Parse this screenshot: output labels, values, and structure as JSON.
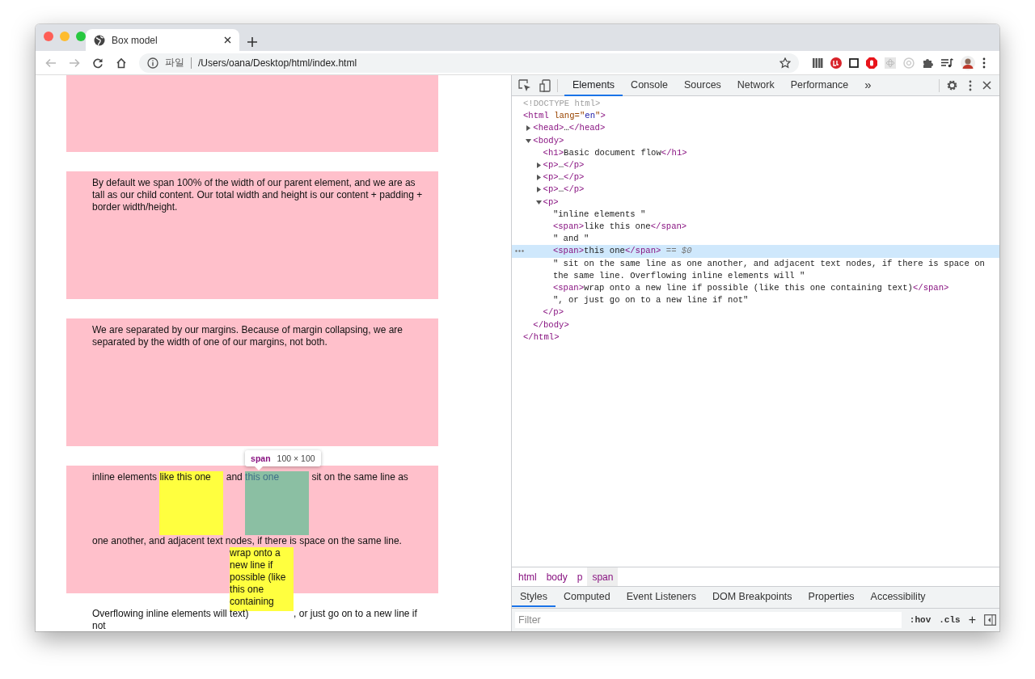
{
  "browser": {
    "tabs": [
      {
        "title": "Box model",
        "selected": true
      }
    ],
    "nav": [
      {
        "kind": "back",
        "disabled": true
      },
      {
        "kind": "forward",
        "disabled": true
      },
      {
        "kind": "reload",
        "disabled": false
      },
      {
        "kind": "home",
        "disabled": false
      }
    ],
    "address": {
      "scheme_label": "파일",
      "url": "/Users/oana/Desktop/html/index.html"
    },
    "extensions": [
      {
        "kind": "bars"
      },
      {
        "kind": "red-badge"
      },
      {
        "kind": "square"
      },
      {
        "kind": "stop-sign"
      },
      {
        "kind": "atom"
      },
      {
        "kind": "ring"
      },
      {
        "kind": "puzzle"
      },
      {
        "kind": "playlist"
      }
    ]
  },
  "page": {
    "blocks": [
      {
        "kind": "empty"
      },
      {
        "kind": "text",
        "text": "By default we span 100% of the width of our parent element, and we are as tall as our child content. Our total width and height is our content + padding + border width/height."
      },
      {
        "kind": "text",
        "text": "We are separated by our margins. Because of margin collapsing, we are separated by the width of one of our margins, not both."
      },
      {
        "kind": "inline",
        "lines": [
          [
            {
              "kind": "text",
              "text": "inline elements "
            },
            {
              "kind": "span",
              "text": "like this one",
              "inspected": false
            },
            {
              "kind": "text",
              "text": " and "
            },
            {
              "kind": "span",
              "text": "this one",
              "inspected": true,
              "tooltip": {
                "tag": "span",
                "size": "100 × 100"
              }
            },
            {
              "kind": "text",
              "text": " sit on the same line as"
            }
          ],
          [
            {
              "kind": "text",
              "text": "one another, and adjacent text nodes, if there is space on the same line."
            }
          ],
          [
            {
              "kind": "text",
              "text": "Overflowing inline elements will "
            },
            {
              "kind": "span",
              "text": "wrap onto a new line if possible (like this one containing text)",
              "inspected": false
            },
            {
              "kind": "text",
              "text": ", or just go on to a new line if"
            }
          ],
          [
            {
              "kind": "text",
              "text": "not"
            }
          ]
        ]
      }
    ]
  },
  "devtools": {
    "tabs": [
      {
        "label": "Elements",
        "selected": true
      },
      {
        "label": "Console",
        "selected": false
      },
      {
        "label": "Sources",
        "selected": false
      },
      {
        "label": "Network",
        "selected": false
      },
      {
        "label": "Performance",
        "selected": false
      }
    ],
    "more_tabs": "»",
    "tree": [
      {
        "selected": false,
        "tokens": [
          {
            "kind": "doctype",
            "text": "<!DOCTYPE html>"
          }
        ]
      },
      {
        "selected": false,
        "tokens": [
          {
            "kind": "tag",
            "text": "<html"
          },
          {
            "kind": "attr",
            "text": " lang=\""
          },
          {
            "kind": "value",
            "text": "en"
          },
          {
            "kind": "attr",
            "text": "\""
          },
          {
            "kind": "tag",
            "text": ">"
          }
        ],
        "close": [
          {
            "kind": "tag",
            "text": "</html>"
          }
        ],
        "children": [
          {
            "selected": false,
            "expanded": false,
            "tokens": [
              {
                "kind": "tag",
                "text": "<head>"
              },
              {
                "kind": "text",
                "text": "…"
              },
              {
                "kind": "tag",
                "text": "</head>"
              }
            ]
          },
          {
            "selected": false,
            "expanded": true,
            "tokens": [
              {
                "kind": "tag",
                "text": "<body>"
              }
            ],
            "close": [
              {
                "kind": "tag",
                "text": "</body>"
              }
            ],
            "children": [
              {
                "selected": false,
                "tokens": [
                  {
                    "kind": "tag",
                    "text": "<h1>"
                  },
                  {
                    "kind": "text",
                    "text": "Basic document flow"
                  },
                  {
                    "kind": "tag",
                    "text": "</h1>"
                  }
                ]
              },
              {
                "selected": false,
                "expanded": false,
                "tokens": [
                  {
                    "kind": "tag",
                    "text": "<p>"
                  },
                  {
                    "kind": "text",
                    "text": "…"
                  },
                  {
                    "kind": "tag",
                    "text": "</p>"
                  }
                ]
              },
              {
                "selected": false,
                "expanded": false,
                "tokens": [
                  {
                    "kind": "tag",
                    "text": "<p>"
                  },
                  {
                    "kind": "text",
                    "text": "…"
                  },
                  {
                    "kind": "tag",
                    "text": "</p>"
                  }
                ]
              },
              {
                "selected": false,
                "expanded": false,
                "tokens": [
                  {
                    "kind": "tag",
                    "text": "<p>"
                  },
                  {
                    "kind": "text",
                    "text": "…"
                  },
                  {
                    "kind": "tag",
                    "text": "</p>"
                  }
                ]
              },
              {
                "selected": false,
                "expanded": true,
                "tokens": [
                  {
                    "kind": "tag",
                    "text": "<p>"
                  }
                ],
                "close": [
                  {
                    "kind": "tag",
                    "text": "</p>"
                  }
                ],
                "children": [
                  {
                    "selected": false,
                    "tokens": [
                      {
                        "kind": "text",
                        "text": "\"inline elements \""
                      }
                    ]
                  },
                  {
                    "selected": false,
                    "tokens": [
                      {
                        "kind": "tag",
                        "text": "<span>"
                      },
                      {
                        "kind": "text",
                        "text": "like this one"
                      },
                      {
                        "kind": "tag",
                        "text": "</span>"
                      }
                    ]
                  },
                  {
                    "selected": false,
                    "tokens": [
                      {
                        "kind": "text",
                        "text": "\" and \""
                      }
                    ]
                  },
                  {
                    "selected": true,
                    "tokens": [
                      {
                        "kind": "tag",
                        "text": "<span>"
                      },
                      {
                        "kind": "text",
                        "text": "this one"
                      },
                      {
                        "kind": "tag",
                        "text": "</span>"
                      },
                      {
                        "kind": "equals",
                        "text": " == "
                      },
                      {
                        "kind": "var",
                        "text": "$0"
                      }
                    ]
                  },
                  {
                    "selected": false,
                    "tokens": [
                      {
                        "kind": "text",
                        "text": "\" sit on the same line as one another, and adjacent text nodes, if there is space on the same line. Overflowing inline elements will \""
                      }
                    ]
                  },
                  {
                    "selected": false,
                    "tokens": [
                      {
                        "kind": "tag",
                        "text": "<span>"
                      },
                      {
                        "kind": "text",
                        "text": "wrap onto a new line if possible (like this one containing text)"
                      },
                      {
                        "kind": "tag",
                        "text": "</span>"
                      }
                    ]
                  },
                  {
                    "selected": false,
                    "tokens": [
                      {
                        "kind": "text",
                        "text": "\", or just go on to a new line if not\""
                      }
                    ]
                  }
                ]
              }
            ]
          }
        ]
      }
    ],
    "breadcrumbs": [
      {
        "label": "html",
        "selected": false
      },
      {
        "label": "body",
        "selected": false
      },
      {
        "label": "p",
        "selected": false
      },
      {
        "label": "span",
        "selected": true
      }
    ],
    "sidebar_tabs": [
      {
        "label": "Styles",
        "selected": true
      },
      {
        "label": "Computed",
        "selected": false
      },
      {
        "label": "Event Listeners",
        "selected": false
      },
      {
        "label": "DOM Breakpoints",
        "selected": false
      },
      {
        "label": "Properties",
        "selected": false
      },
      {
        "label": "Accessibility",
        "selected": false
      }
    ],
    "filter": {
      "placeholder": "Filter",
      "hov": ":hov",
      "cls": ".cls",
      "add": "+"
    }
  }
}
